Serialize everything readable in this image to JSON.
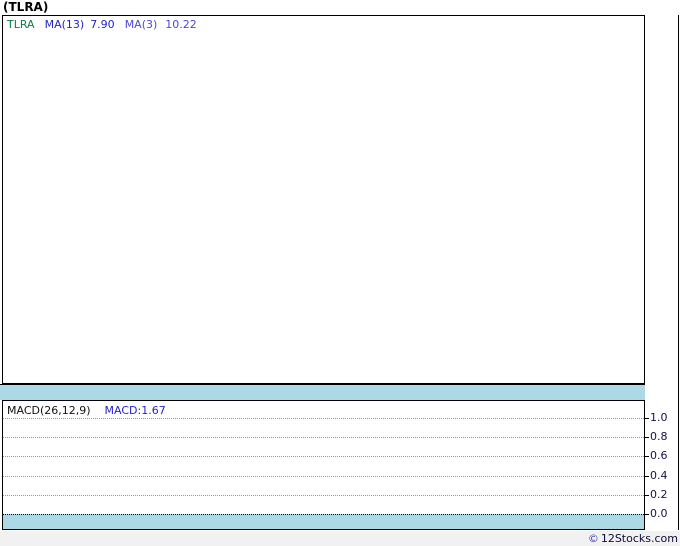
{
  "title": "(TLRA)",
  "main_chart": {
    "legend": {
      "symbol": "TLRA",
      "ma1_label": "MA(13)",
      "ma1_value": "7.90",
      "ma2_label": "MA(3)",
      "ma2_value": "10.22"
    }
  },
  "macd_panel": {
    "legend_name": "MACD(26,12,9)",
    "legend_value": "MACD:1.67",
    "axis_ticks": [
      "1.0",
      "0.8",
      "0.6",
      "0.4",
      "0.2",
      "0.0"
    ]
  },
  "footer": {
    "copyright": "©",
    "brand": "12Stocks.com"
  },
  "colors": {
    "band_blue": "#ADD8E6",
    "symbol_green": "#0b7d46",
    "indicator_blue": "#2323cb",
    "axis_label_navy": "#13134a"
  },
  "chart_data": [
    {
      "type": "line",
      "title": "(TLRA) price panel",
      "legend": [
        "TLRA",
        "MA(13) 7.90",
        "MA(3) 10.22"
      ],
      "indicators": {
        "MA13": 7.9,
        "MA3": 10.22
      },
      "series": [],
      "note": "price panel is rendered empty - no visible candles or lines",
      "grid": false
    },
    {
      "type": "line",
      "title": "MACD(26,12,9)",
      "legend": [
        "MACD:1.67"
      ],
      "indicators": {
        "MACD": 1.67
      },
      "series": [],
      "note": "MACD panel rendered empty - gridlines and axis only",
      "ylim": [
        0.0,
        1.0
      ],
      "yticks": [
        1.0,
        0.8,
        0.6,
        0.4,
        0.2,
        0.0
      ],
      "grid": true,
      "legend_position": "top-left"
    }
  ]
}
